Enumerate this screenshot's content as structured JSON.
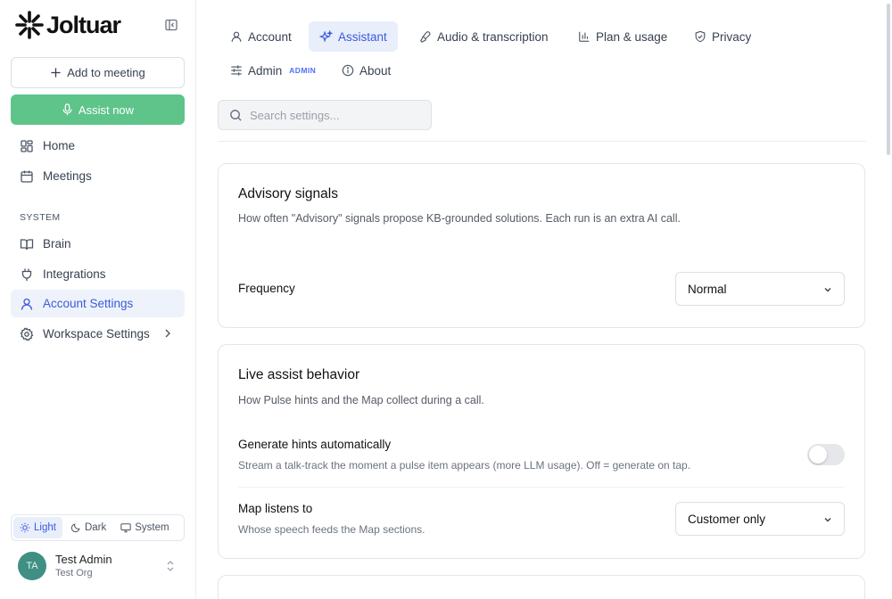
{
  "app": {
    "name": "Joltuar"
  },
  "sidebar": {
    "add_meeting_label": "Add to meeting",
    "assist_now_label": "Assist now",
    "nav": [
      {
        "label": "Home",
        "icon": "grid-icon"
      },
      {
        "label": "Meetings",
        "icon": "calendar-icon"
      }
    ],
    "section_label": "SYSTEM",
    "system_nav": [
      {
        "label": "Brain",
        "icon": "book-icon"
      },
      {
        "label": "Integrations",
        "icon": "plug-icon"
      },
      {
        "label": "Account Settings",
        "icon": "user-icon",
        "active": true
      },
      {
        "label": "Workspace Settings",
        "icon": "gear-icon"
      }
    ],
    "theme": {
      "light": "Light",
      "dark": "Dark",
      "system": "System",
      "selected": "Light"
    },
    "user": {
      "initials": "TA",
      "name": "Test Admin",
      "org": "Test Org"
    }
  },
  "tabs": [
    {
      "label": "Account",
      "icon": "user-icon"
    },
    {
      "label": "Assistant",
      "icon": "sparkle-icon",
      "active": true
    },
    {
      "label": "Audio & transcription",
      "icon": "mic-icon"
    },
    {
      "label": "Plan & usage",
      "icon": "bar-chart-icon"
    },
    {
      "label": "Privacy",
      "icon": "shield-icon"
    },
    {
      "label": "Admin",
      "icon": "sliders-icon",
      "badge": "ADMIN"
    },
    {
      "label": "About",
      "icon": "info-icon"
    }
  ],
  "search": {
    "placeholder": "Search settings..."
  },
  "cards": {
    "advisory": {
      "title": "Advisory signals",
      "description": "How often \"Advisory\" signals propose KB-grounded solutions. Each run is an extra AI call.",
      "frequency_label": "Frequency",
      "frequency_value": "Normal"
    },
    "live_assist": {
      "title": "Live assist behavior",
      "description": "How Pulse hints and the Map collect during a call.",
      "hints_label": "Generate hints automatically",
      "hints_description": "Stream a talk-track the moment a pulse item appears (more LLM usage). Off = generate on tap.",
      "hints_enabled": false,
      "map_label": "Map listens to",
      "map_description": "Whose speech feeds the Map sections.",
      "map_value": "Customer only"
    }
  },
  "colors": {
    "accent": "#3b5bdb",
    "assist_green": "#5ec48a",
    "active_bg": "#e9eefb",
    "avatar": "#3f8f85"
  }
}
